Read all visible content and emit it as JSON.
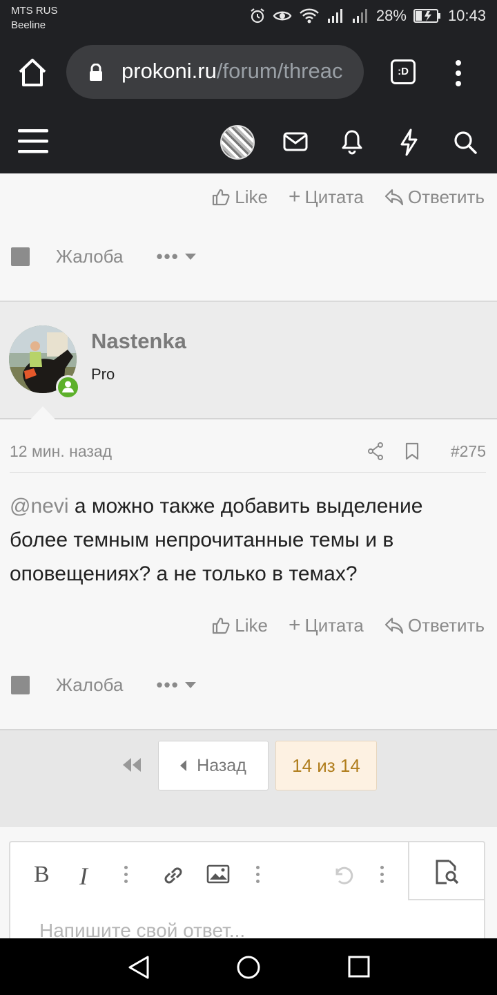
{
  "status": {
    "carrier_1": "MTS RUS",
    "carrier_2": "Beeline",
    "battery": "28%",
    "time": "10:43"
  },
  "browser": {
    "url_host": "prokoni.ru",
    "url_path": "/forum/threac",
    "tabs_label": ":D"
  },
  "prev_post": {
    "like": "Like",
    "quote": "Цитата",
    "reply": "Ответить",
    "report": "Жалоба"
  },
  "post": {
    "username": "Nastenka",
    "user_title": "Pro",
    "time": "12 мин. назад",
    "number": "#275",
    "mention": "@nevi",
    "text": " а можно также добавить выделение более темным непрочитанные темы и в оповещениях? а не только в темах?",
    "like": "Like",
    "quote": "Цитата",
    "reply": "Ответить",
    "report": "Жалоба"
  },
  "pager": {
    "back_label": "Назад",
    "current_label": "14 из 14"
  },
  "editor": {
    "bold": "B",
    "italic": "I",
    "placeholder": "Напишите свой ответ..."
  },
  "colors": {
    "header_bg": "#202124",
    "online": "#5cb02a",
    "page_highlight": "#fdf1e2",
    "page_highlight_text": "#b07d1c"
  }
}
